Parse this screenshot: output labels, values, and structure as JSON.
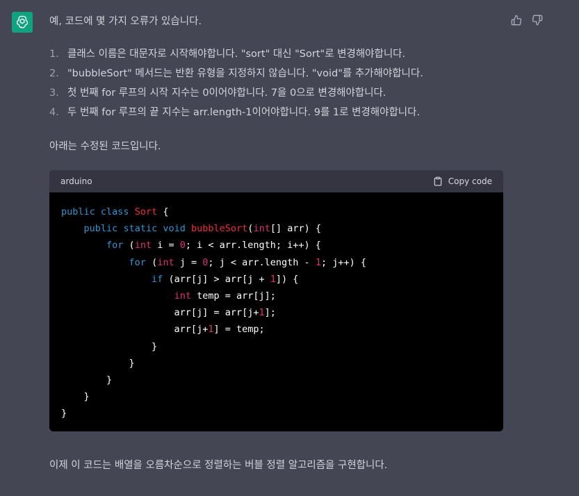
{
  "message": {
    "intro": "예, 코드에 몇 가지 오류가 있습니다.",
    "items": [
      {
        "num": "1.",
        "text": "클래스 이름은 대문자로 시작해야합니다. \"sort\" 대신 \"Sort\"로 변경해야합니다."
      },
      {
        "num": "2.",
        "text": "\"bubbleSort\" 메서드는 반환 유형을 지정하지 않습니다. \"void\"를 추가해야합니다."
      },
      {
        "num": "3.",
        "text": "첫 번째 for 루프의 시작 지수는 0이어야합니다. 7을 0으로 변경해야합니다."
      },
      {
        "num": "4.",
        "text": "두 번째 for 루프의 끝 지수는 arr.length-1이어야합니다. 9를 1로 변경해야합니다."
      }
    ],
    "below_list": "아래는 수정된 코드입니다.",
    "outro": "이제 이 코드는 배열을 오름차순으로 정렬하는 버블 정렬 알고리즘을 구현합니다."
  },
  "code_block": {
    "language": "arduino",
    "copy_label": "Copy code",
    "lines": [
      "public class Sort {",
      "    public static void bubbleSort(int[] arr) {",
      "        for (int i = 0; i < arr.length; i++) {",
      "            for (int j = 0; j < arr.length - 1; j++) {",
      "                if (arr[j] > arr[j + 1]) {",
      "                    int temp = arr[j];",
      "                    arr[j] = arr[j+1];",
      "                    arr[j+1] = temp;",
      "                }",
      "            }",
      "        }",
      "    }",
      "}"
    ]
  },
  "icons": {
    "avatar": "openai-logo-icon",
    "thumbs_up": "thumbs-up-icon",
    "thumbs_down": "thumbs-down-icon",
    "copy": "clipboard-icon"
  },
  "colors": {
    "background": "#444654",
    "avatar": "#10a37f",
    "code_bg": "#000000",
    "code_header": "#343541",
    "keyword": "#2e95d3",
    "class_name": "#f22c3d",
    "number": "#df3079"
  }
}
